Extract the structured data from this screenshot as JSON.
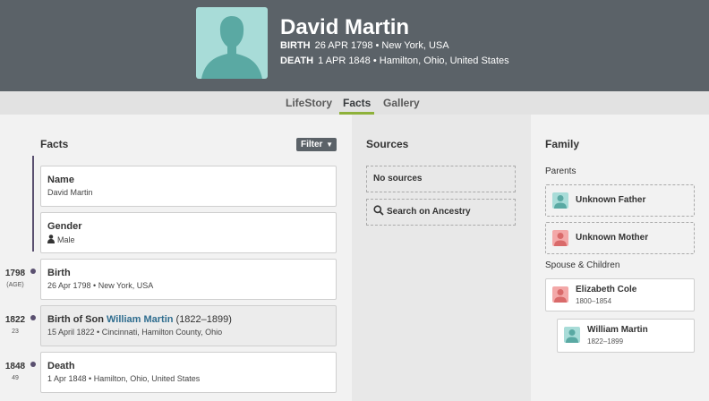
{
  "person": {
    "name": "David Martin",
    "birth_label": "BIRTH",
    "birth_value": "26 APR 1798 • New York, USA",
    "death_label": "DEATH",
    "death_value": "1 APR 1848 • Hamilton, Ohio, United States"
  },
  "tabs": [
    {
      "label": "LifeStory",
      "active": false
    },
    {
      "label": "Facts",
      "active": true
    },
    {
      "label": "Gallery",
      "active": false
    }
  ],
  "facts": {
    "title": "Facts",
    "filter_label": "Filter",
    "items": [
      {
        "title": "Name",
        "sub": "David Martin"
      },
      {
        "title": "Gender",
        "sub": "Male"
      },
      {
        "title": "Birth",
        "sub": "26 Apr 1798 • New York, USA"
      },
      {
        "title_prefix": "Birth of Son ",
        "title_link": "William Martin",
        "title_years": " (1822–1899)",
        "sub": "15 April 1822 • Cincinnati, Hamilton County, Ohio"
      },
      {
        "title": "Death",
        "sub": "1 Apr 1848 • Hamilton, Ohio, United States"
      }
    ]
  },
  "timeline": [
    {
      "year": "1798",
      "age": "(AGE)"
    },
    {
      "year": "1822",
      "age": "23"
    },
    {
      "year": "1848",
      "age": "49"
    }
  ],
  "sources": {
    "title": "Sources",
    "empty_label": "No sources",
    "search_label": "Search on Ancestry"
  },
  "family": {
    "title": "Family",
    "parents_label": "Parents",
    "father": "Unknown Father",
    "mother": "Unknown Mother",
    "spouse_label": "Spouse & Children",
    "spouse": {
      "name": "Elizabeth Cole",
      "years": "1800–1854"
    },
    "child": {
      "name": "William Martin",
      "years": "1822–1899"
    }
  },
  "colors": {
    "header_bg": "#5b6268",
    "tab_active_underline": "#8eb13a",
    "link": "#2f6d8f",
    "male_avatar": "#a8dcd8",
    "female_avatar": "#f3a8a8",
    "timeline": "#5a5070"
  }
}
